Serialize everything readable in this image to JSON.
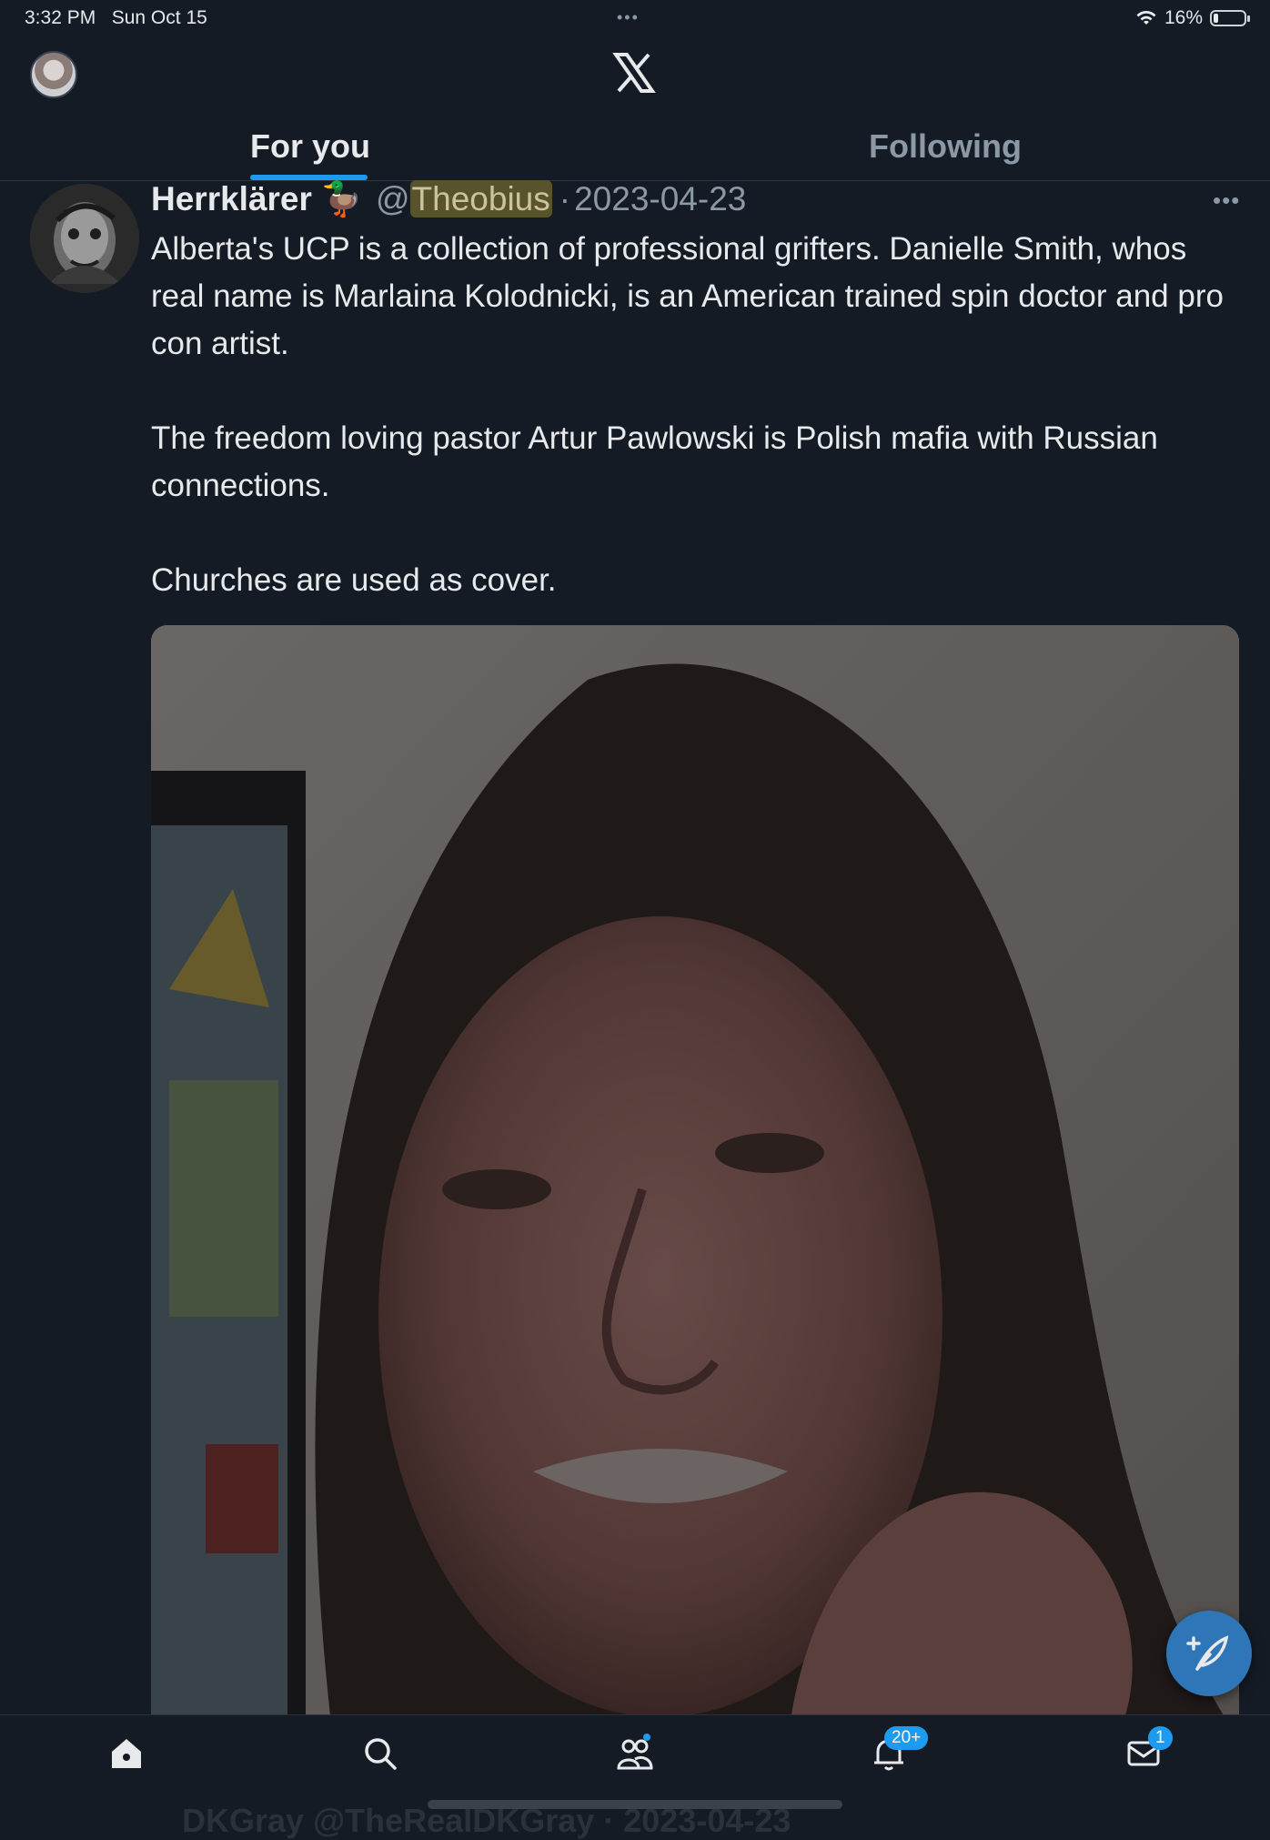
{
  "status_bar": {
    "time": "3:32 PM",
    "date": "Sun Oct 15",
    "dots": "•••",
    "battery_percent_text": "16%",
    "battery_level": 0.16
  },
  "header": {
    "logo": "x-logo-icon",
    "avatar": "profile-avatar"
  },
  "tabs": [
    {
      "label": "For you",
      "active": true
    },
    {
      "label": "Following",
      "active": false
    }
  ],
  "tweet": {
    "author_name": "Herrklärer",
    "author_emoji": "🦆",
    "handle_prefix": "@",
    "handle": "Theobius",
    "separator": "·",
    "date": "2023-04-23",
    "more": "•••",
    "paragraphs": [
      "Alberta's UCP is a collection of professional grifters. Danielle Smith, whos real name is Marlaina Kolodnicki, is an American trained spin doctor and pro con artist.",
      "The freedom loving pastor Artur Pawlowski is Polish mafia with Russian connections.",
      "Churches are used as cover."
    ]
  },
  "compose_fab": "compose-feather-icon",
  "bottom_nav": {
    "items": [
      "home-icon",
      "search-icon",
      "communities-icon",
      "notifications-bell-icon",
      "messages-envelope-icon"
    ],
    "notifications_badge": "20+",
    "messages_badge": "1"
  },
  "next_tweet_peek": "DKGray @TheRealDKGray · 2023-04-23",
  "colors": {
    "background": "#141b25",
    "accent": "#1d9bf0",
    "text_primary": "#e7e9ea",
    "text_secondary": "#8b98a5"
  }
}
